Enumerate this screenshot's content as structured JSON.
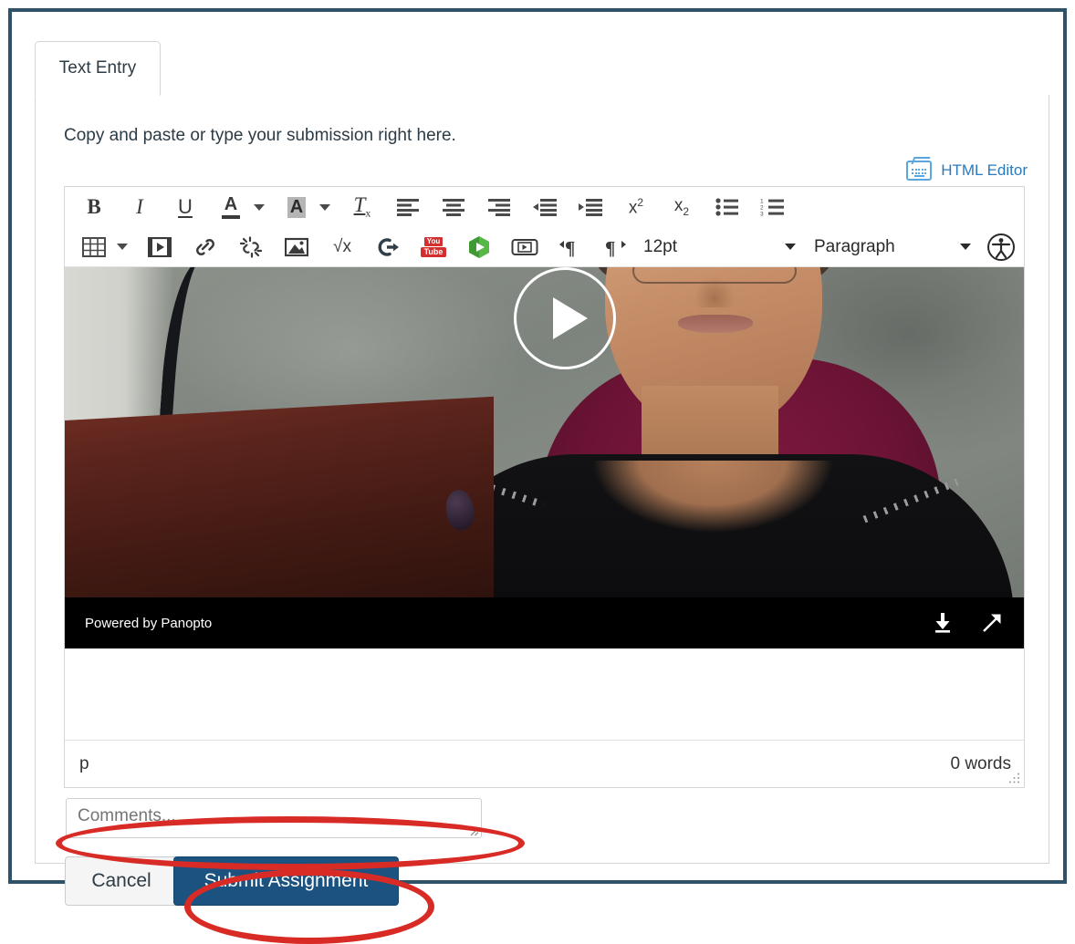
{
  "window": {
    "frame_color": "#2e5368"
  },
  "tabs": [
    {
      "label": "Text Entry",
      "active": true
    }
  ],
  "instructions": "Copy and paste or type your submission right here.",
  "html_editor": {
    "label": "HTML Editor",
    "icon": "keyboard-icon",
    "color": "#2b7abc"
  },
  "toolbar": {
    "row1": [
      {
        "name": "bold-button",
        "label": "B",
        "tooltip": "Bold"
      },
      {
        "name": "italic-button",
        "label": "I",
        "tooltip": "Italic"
      },
      {
        "name": "underline-button",
        "label": "U",
        "tooltip": "Underline"
      },
      {
        "name": "text-color-button",
        "label": "A",
        "tooltip": "Text color",
        "has_caret": true
      },
      {
        "name": "background-color-button",
        "label": "A",
        "tooltip": "Background color",
        "has_caret": true,
        "highlighted": true
      },
      {
        "name": "clear-formatting-button",
        "label": "Tx",
        "tooltip": "Clear formatting"
      },
      {
        "name": "align-left-button",
        "tooltip": "Align left"
      },
      {
        "name": "align-center-button",
        "tooltip": "Align center"
      },
      {
        "name": "align-right-button",
        "tooltip": "Align right"
      },
      {
        "name": "outdent-button",
        "tooltip": "Decrease indent"
      },
      {
        "name": "indent-button",
        "tooltip": "Increase indent"
      },
      {
        "name": "superscript-button",
        "label": "x2",
        "tooltip": "Superscript"
      },
      {
        "name": "subscript-button",
        "label": "x2",
        "tooltip": "Subscript"
      },
      {
        "name": "bullet-list-button",
        "tooltip": "Bulleted list"
      },
      {
        "name": "numbered-list-button",
        "tooltip": "Numbered list"
      }
    ],
    "row2": [
      {
        "name": "table-button",
        "tooltip": "Table",
        "has_caret": true
      },
      {
        "name": "media-button",
        "tooltip": "Insert media"
      },
      {
        "name": "link-button",
        "tooltip": "Insert link"
      },
      {
        "name": "unlink-button",
        "tooltip": "Remove link"
      },
      {
        "name": "image-button",
        "tooltip": "Insert image"
      },
      {
        "name": "math-button",
        "label": "√x",
        "tooltip": "Insert math equation"
      },
      {
        "name": "embed-button",
        "tooltip": "Embed"
      },
      {
        "name": "youtube-button",
        "label_top": "You",
        "label_bottom": "Tube",
        "tooltip": "YouTube"
      },
      {
        "name": "office-mix-button",
        "tooltip": "Office Mix"
      },
      {
        "name": "video-embed-button",
        "tooltip": "Video"
      },
      {
        "name": "ltr-button",
        "tooltip": "Left to right"
      },
      {
        "name": "rtl-button",
        "tooltip": "Right to left"
      }
    ],
    "font_size": {
      "name": "font-size-select",
      "value": "12pt"
    },
    "format": {
      "name": "paragraph-format-select",
      "value": "Paragraph"
    },
    "accessibility": {
      "name": "accessibility-checker-button",
      "tooltip": "Accessibility checker"
    }
  },
  "video": {
    "provider_label": "Powered by Panopto",
    "play_button_label": "Play",
    "actions": [
      {
        "name": "download-icon",
        "label": "Download"
      },
      {
        "name": "open-external-icon",
        "label": "Open in new window"
      }
    ]
  },
  "editor_status": {
    "element_path": "p",
    "word_count": "0 words"
  },
  "comments": {
    "placeholder": "Comments...",
    "value": ""
  },
  "actions": {
    "cancel_label": "Cancel",
    "submit_label": "Submit Assignment",
    "submit_color": "#1c5280"
  },
  "annotations": [
    {
      "name": "comments-highlight",
      "shape": "ellipse",
      "color": "#d92b25",
      "target": "comments-input"
    },
    {
      "name": "submit-highlight",
      "shape": "ellipse",
      "color": "#d92b25",
      "target": "submit-button"
    }
  ]
}
